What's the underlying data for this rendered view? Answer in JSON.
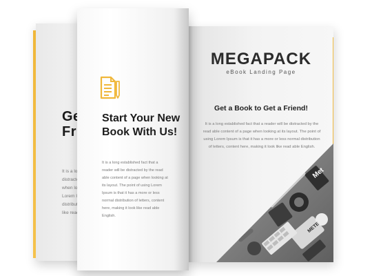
{
  "back_page": {
    "title": "Get a\nFrie",
    "body": "It is a long\ndistracted\nwhen looki\nLorem Ipsu\ndistributio\nlike read ab"
  },
  "turn_page": {
    "icon": "document-pencil-icon",
    "heading": "Start Your New Book With Us!",
    "body": "It is a long established fact that a reader will be distracted by the read able content of a page when looking at its layout. The point of using Lorem Ipsum is that it has a more or less normal distribution of letters, content here, making it look like read able English."
  },
  "right_page": {
    "brand": "MEGAPACK",
    "subtitle": "eBook Landing Page",
    "heading": "Get a Book to Get a Friend!",
    "body": "It is a long established fact that a reader will be distracted by the read able content of a page when looking at its layout. The point of using Lorem Ipsum is that it has a more or less normal distribution of letters, content here, making it look like read able English.",
    "photo_labels": [
      "Met",
      "METE"
    ]
  },
  "colors": {
    "accent": "#f0b73a",
    "text_dark": "#1c1c1c",
    "text_muted": "#7a7a7a"
  }
}
